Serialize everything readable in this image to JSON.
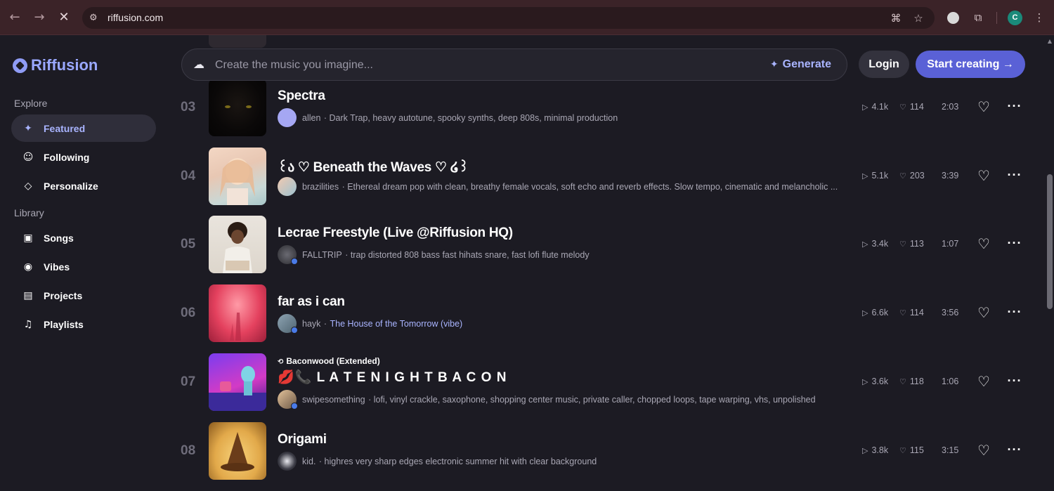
{
  "browser": {
    "url": "riffusion.com",
    "profile_initial": "C"
  },
  "sidebar": {
    "logo": "Riffusion",
    "explore_label": "Explore",
    "explore_items": [
      {
        "label": "Featured",
        "icon": "sparkle-icon"
      },
      {
        "label": "Following",
        "icon": "smile-icon"
      },
      {
        "label": "Personalize",
        "icon": "gem-icon"
      }
    ],
    "library_label": "Library",
    "library_items": [
      {
        "label": "Songs",
        "icon": "music-box-icon"
      },
      {
        "label": "Vibes",
        "icon": "vibe-icon"
      },
      {
        "label": "Projects",
        "icon": "briefcase-icon"
      },
      {
        "label": "Playlists",
        "icon": "playlist-icon"
      }
    ]
  },
  "header": {
    "prompt_placeholder": "Create the music you imagine...",
    "generate_label": "Generate",
    "login_label": "Login",
    "start_label": "Start creating →"
  },
  "tracks": [
    {
      "num": "03",
      "title": "Spectra",
      "user": "allen",
      "desc": "· Dark Trap, heavy autotune, spooky synths, deep 808s, minimal production",
      "plays": "4.1k",
      "likes": "114",
      "duration": "2:03"
    },
    {
      "num": "04",
      "title": "꒰ა ♡ Beneath the Waves ♡ ໒꒱",
      "user": "brazilities",
      "desc": "· Ethereal dream pop with clean, breathy female vocals, soft echo and reverb effects. Slow tempo, cinematic and melancholic ...",
      "plays": "5.1k",
      "likes": "203",
      "duration": "3:39"
    },
    {
      "num": "05",
      "title": "Lecrae Freestyle (Live @Riffusion HQ)",
      "user": "FALLTRIP",
      "desc": "· trap distorted 808 bass fast hihats snare, fast lofi flute melody",
      "plays": "3.4k",
      "likes": "113",
      "duration": "1:07"
    },
    {
      "num": "06",
      "title": "far as i can",
      "user": "hayk",
      "desc": "·",
      "link": "The House of the Tomorrow (vibe)",
      "plays": "6.6k",
      "likes": "114",
      "duration": "3:56"
    },
    {
      "num": "07",
      "subtitle": "Baconwood (Extended)",
      "title": "💋📞 L A T E   N I G H T   B A C O N",
      "user": "swipesomething",
      "desc": "· lofi, vinyl crackle, saxophone, shopping center music, private caller, chopped loops, tape warping, vhs, unpolished",
      "plays": "3.6k",
      "likes": "118",
      "duration": "1:06"
    },
    {
      "num": "08",
      "title": "Origami",
      "user": "kid.",
      "desc": "· highres very sharp edges electronic summer hit with clear background",
      "plays": "3.8k",
      "likes": "115",
      "duration": "3:15"
    }
  ],
  "colors": {
    "accent": "#a9b4ff",
    "button_primary": "#5a61d6",
    "background": "#1c1b23"
  }
}
